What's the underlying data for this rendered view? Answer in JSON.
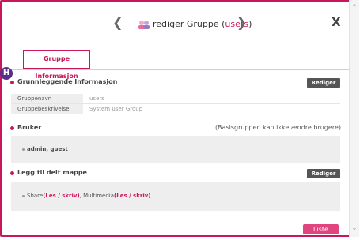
{
  "header": {
    "title_prefix": "rediger Gruppe (",
    "title_group": "users",
    "title_suffix": ")",
    "close_label": "X"
  },
  "tabs": [
    {
      "label": "Gruppe Informasjon"
    }
  ],
  "help_badge": "H",
  "sections": {
    "basic": {
      "title": "Grunnleggende Informasjon",
      "edit_label": "Rediger",
      "rows": [
        {
          "key": "Gruppenavn",
          "value": "users"
        },
        {
          "key": "Gruppebeskrivelse",
          "value": "System user Group"
        }
      ]
    },
    "users": {
      "title": "Bruker",
      "note": "(Basisgruppen kan ikke ændre brugere)",
      "list": "admin, guest"
    },
    "shares": {
      "title": "Legg til delt mappe",
      "edit_label": "Rediger",
      "items": [
        {
          "name": "Share",
          "perm": "Les / skriv",
          "sep": ", "
        },
        {
          "name": "Multimedia",
          "perm": "Les / skriv",
          "sep": ""
        }
      ]
    }
  },
  "footer": {
    "list_label": "Liste"
  },
  "colors": {
    "accent": "#c8175a",
    "badge": "#5b2d8a",
    "button_dark": "#555555",
    "list_button": "#e0457f"
  }
}
